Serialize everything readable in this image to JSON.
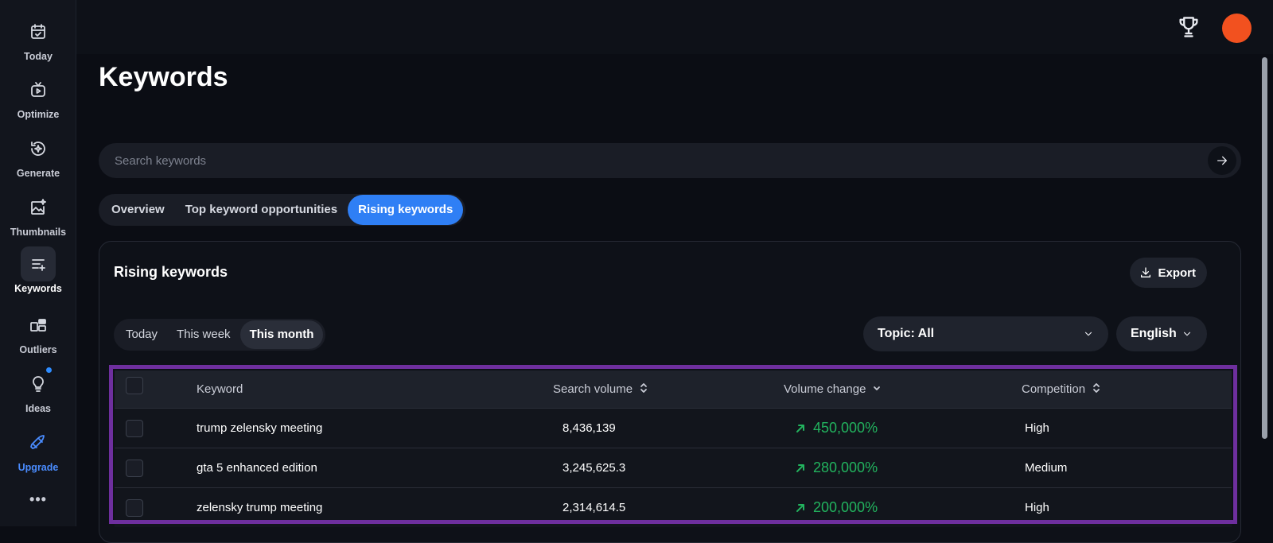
{
  "sidebar": {
    "items": [
      {
        "label": "Today",
        "icon": "calendar-check-icon"
      },
      {
        "label": "Optimize",
        "icon": "video-play-icon"
      },
      {
        "label": "Generate",
        "icon": "sparkle-refresh-icon"
      },
      {
        "label": "Thumbnails",
        "icon": "image-sparkle-icon"
      },
      {
        "label": "Keywords",
        "icon": "list-add-icon"
      },
      {
        "label": "Outliers",
        "icon": "grid-blocks-icon"
      },
      {
        "label": "Ideas",
        "icon": "lightbulb-icon"
      },
      {
        "label": "Upgrade",
        "icon": "rocket-icon"
      }
    ],
    "more": "•••"
  },
  "header": {
    "trophy_icon": "trophy-icon",
    "avatar_color": "#f2511f"
  },
  "page": {
    "title": "Keywords",
    "search": {
      "placeholder": "Search keywords",
      "value": ""
    },
    "tabs": [
      "Overview",
      "Top keyword opportunities",
      "Rising keywords"
    ],
    "active_tab": "Rising keywords"
  },
  "card": {
    "title": "Rising keywords",
    "export_label": "Export",
    "periods": [
      "Today",
      "This week",
      "This month"
    ],
    "active_period": "This month",
    "topic_filter": "Topic: All",
    "language": "English",
    "table": {
      "headers": {
        "keyword": "Keyword",
        "search_volume": "Search volume",
        "volume_change": "Volume change",
        "competition": "Competition"
      },
      "rows": [
        {
          "keyword": "trump zelensky meeting",
          "search_volume": "8,436,139",
          "volume_change": "450,000%",
          "competition": "High"
        },
        {
          "keyword": "gta 5 enhanced edition",
          "search_volume": "3,245,625.3",
          "volume_change": "280,000%",
          "competition": "Medium"
        },
        {
          "keyword": "zelensky trump meeting",
          "search_volume": "2,314,614.5",
          "volume_change": "200,000%",
          "competition": "High"
        }
      ]
    }
  },
  "colors": {
    "accent": "#2f7ff5",
    "positive": "#22b35e",
    "highlight_border": "#6e2f9e"
  }
}
